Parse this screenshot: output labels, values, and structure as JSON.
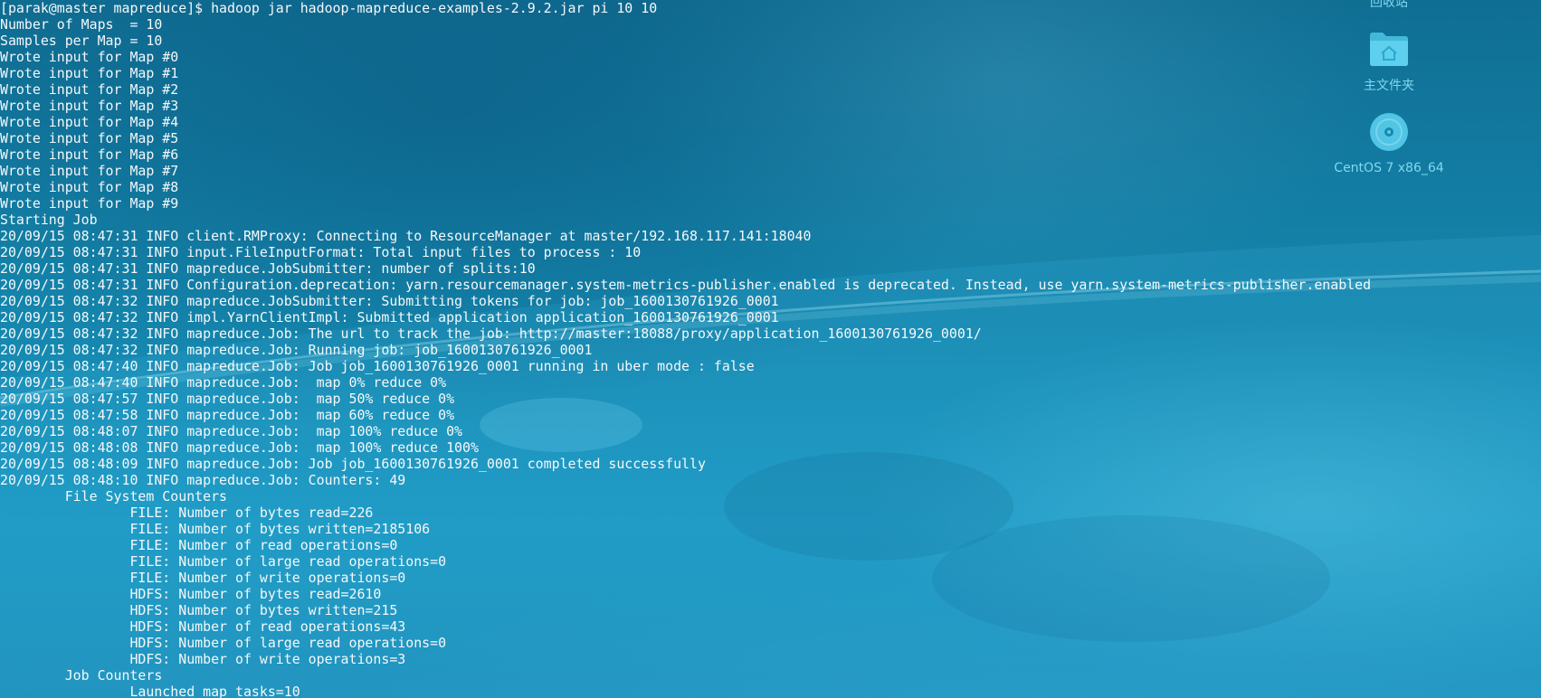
{
  "terminal": {
    "lines": [
      "[parak@master mapreduce]$ hadoop jar hadoop-mapreduce-examples-2.9.2.jar pi 10 10",
      "Number of Maps  = 10",
      "Samples per Map = 10",
      "Wrote input for Map #0",
      "Wrote input for Map #1",
      "Wrote input for Map #2",
      "Wrote input for Map #3",
      "Wrote input for Map #4",
      "Wrote input for Map #5",
      "Wrote input for Map #6",
      "Wrote input for Map #7",
      "Wrote input for Map #8",
      "Wrote input for Map #9",
      "Starting Job",
      "20/09/15 08:47:31 INFO client.RMProxy: Connecting to ResourceManager at master/192.168.117.141:18040",
      "20/09/15 08:47:31 INFO input.FileInputFormat: Total input files to process : 10",
      "20/09/15 08:47:31 INFO mapreduce.JobSubmitter: number of splits:10",
      "20/09/15 08:47:31 INFO Configuration.deprecation: yarn.resourcemanager.system-metrics-publisher.enabled is deprecated. Instead, use yarn.system-metrics-publisher.enabled",
      "20/09/15 08:47:32 INFO mapreduce.JobSubmitter: Submitting tokens for job: job_1600130761926_0001",
      "20/09/15 08:47:32 INFO impl.YarnClientImpl: Submitted application application_1600130761926_0001",
      "20/09/15 08:47:32 INFO mapreduce.Job: The url to track the job: http://master:18088/proxy/application_1600130761926_0001/",
      "20/09/15 08:47:32 INFO mapreduce.Job: Running job: job_1600130761926_0001",
      "20/09/15 08:47:40 INFO mapreduce.Job: Job job_1600130761926_0001 running in uber mode : false",
      "20/09/15 08:47:40 INFO mapreduce.Job:  map 0% reduce 0%",
      "20/09/15 08:47:57 INFO mapreduce.Job:  map 50% reduce 0%",
      "20/09/15 08:47:58 INFO mapreduce.Job:  map 60% reduce 0%",
      "20/09/15 08:48:07 INFO mapreduce.Job:  map 100% reduce 0%",
      "20/09/15 08:48:08 INFO mapreduce.Job:  map 100% reduce 100%",
      "20/09/15 08:48:09 INFO mapreduce.Job: Job job_1600130761926_0001 completed successfully",
      "20/09/15 08:48:10 INFO mapreduce.Job: Counters: 49",
      "\tFile System Counters",
      "\t\tFILE: Number of bytes read=226",
      "\t\tFILE: Number of bytes written=2185106",
      "\t\tFILE: Number of read operations=0",
      "\t\tFILE: Number of large read operations=0",
      "\t\tFILE: Number of write operations=0",
      "\t\tHDFS: Number of bytes read=2610",
      "\t\tHDFS: Number of bytes written=215",
      "\t\tHDFS: Number of read operations=43",
      "\t\tHDFS: Number of large read operations=0",
      "\t\tHDFS: Number of write operations=3",
      "\tJob Counters",
      "\t\tLaunched map tasks=10"
    ]
  },
  "desktop": {
    "trash_label": "回收站",
    "home_folder_label": "主文件夹",
    "cd_label": "CentOS 7 x86_64"
  },
  "icons": {
    "trash": "trash-icon",
    "home": "home-folder-icon",
    "cd": "optical-disc-icon"
  }
}
